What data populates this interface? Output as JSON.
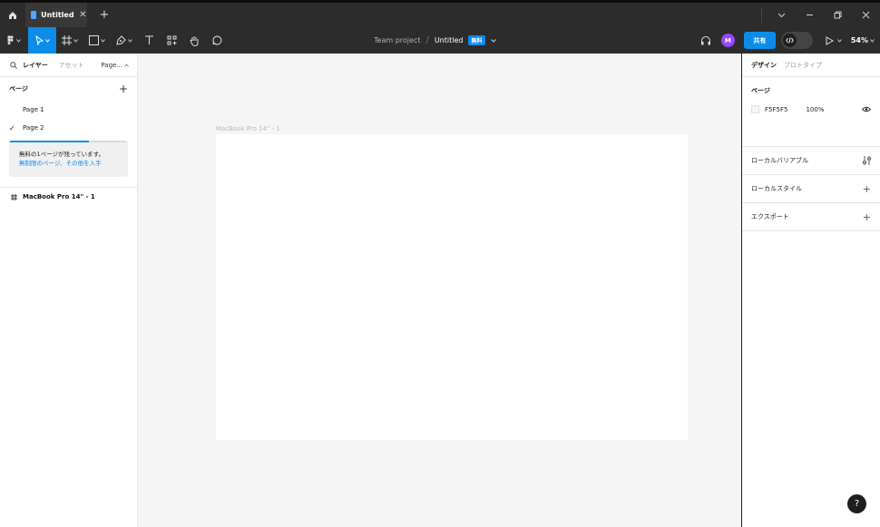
{
  "titlebar": {
    "tab_title": "Untitled",
    "tab_close": "✕",
    "new_tab": "+"
  },
  "toolbar": {
    "project": "Team project",
    "separator": "/",
    "file": "Untitled",
    "plan_badge": "無料",
    "avatar_initial": "M",
    "share_label": "共有",
    "zoom": "54%"
  },
  "left_panel": {
    "tabs": {
      "layers": "レイヤー",
      "assets": "アセット",
      "pages": "Page..."
    },
    "pages_title": "ページ",
    "pages_add": "+",
    "pages": [
      {
        "label": "Page 1",
        "current": false
      },
      {
        "label": "Page 2",
        "current": true
      }
    ],
    "notice": {
      "text": "無料の1ページが残っています。",
      "link": "無制限のページ、その他を入手",
      "progress": 0.67
    },
    "layers": [
      {
        "label": "MacBook Pro 14\" - 1"
      }
    ]
  },
  "canvas": {
    "frame_label": "MacBook Pro 14\" - 1",
    "background": "#F5F5F5"
  },
  "right_panel": {
    "tabs": {
      "design": "デザイン",
      "prototype": "プロトタイプ"
    },
    "page_section_title": "ページ",
    "fill_hex": "F5F5F5",
    "fill_opacity": "100%",
    "local_variables": "ローカルバリアブル",
    "local_styles": "ローカルスタイル",
    "export": "エクスポート",
    "add_symbol": "+"
  },
  "help": "?",
  "colors": {
    "accent": "#0C8CE9",
    "avatar": "#9747FF",
    "chrome": "#2C2C2C"
  }
}
